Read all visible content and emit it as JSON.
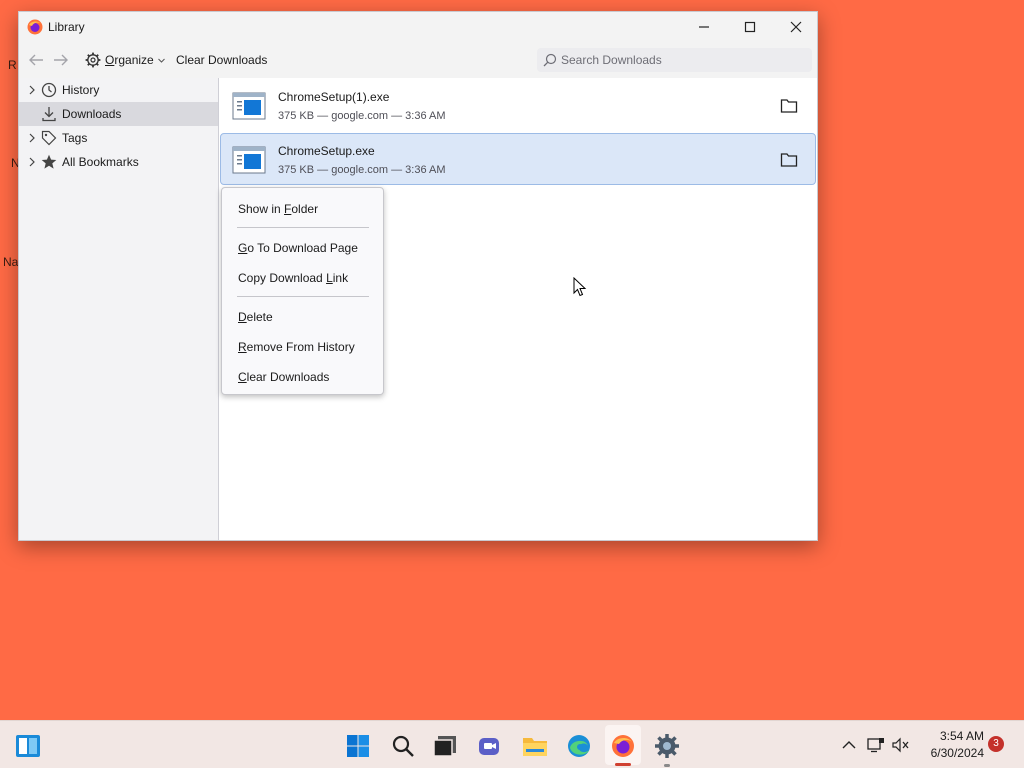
{
  "window": {
    "title": "Library",
    "minimize_icon": "minimize-icon",
    "maximize_icon": "maximize-icon",
    "close_icon": "close-icon"
  },
  "toolbar": {
    "organize_label": "Organize",
    "clear_downloads_label": "Clear Downloads",
    "search_placeholder": "Search Downloads"
  },
  "sidebar": {
    "items": [
      {
        "label": "History",
        "icon": "clock-icon",
        "expandable": true
      },
      {
        "label": "Downloads",
        "icon": "download-icon",
        "expandable": false,
        "selected": true
      },
      {
        "label": "Tags",
        "icon": "tag-icon",
        "expandable": true
      },
      {
        "label": "All Bookmarks",
        "icon": "star-icon",
        "expandable": true
      }
    ]
  },
  "downloads": [
    {
      "name": "ChromeSetup(1).exe",
      "meta": "375 KB — google.com — 3:36 AM",
      "selected": false
    },
    {
      "name": "ChromeSetup.exe",
      "meta": "375 KB — google.com — 3:36 AM",
      "selected": true
    }
  ],
  "context_menu": {
    "items": [
      {
        "label": "Show in Folder",
        "access_key": "F"
      },
      {
        "label": "Go To Download Page",
        "access_key": "G"
      },
      {
        "label": "Copy Download Link",
        "access_key": "L"
      },
      {
        "label": "Delete",
        "access_key": "D"
      },
      {
        "label": "Remove From History",
        "access_key": "R"
      },
      {
        "label": "Clear Downloads",
        "access_key": "C"
      }
    ]
  },
  "taskbar": {
    "apps": [
      "start-icon",
      "search-icon",
      "task-view-icon",
      "chat-icon",
      "file-explorer-icon",
      "edge-icon",
      "firefox-icon",
      "settings-icon"
    ],
    "active_app": "firefox-icon",
    "time": "3:54 AM",
    "date": "6/30/2024",
    "notification_count": "3"
  },
  "colors": {
    "desktop": "#ff6a45",
    "selection": "#dbe7f8",
    "accent": "#0078d4"
  }
}
